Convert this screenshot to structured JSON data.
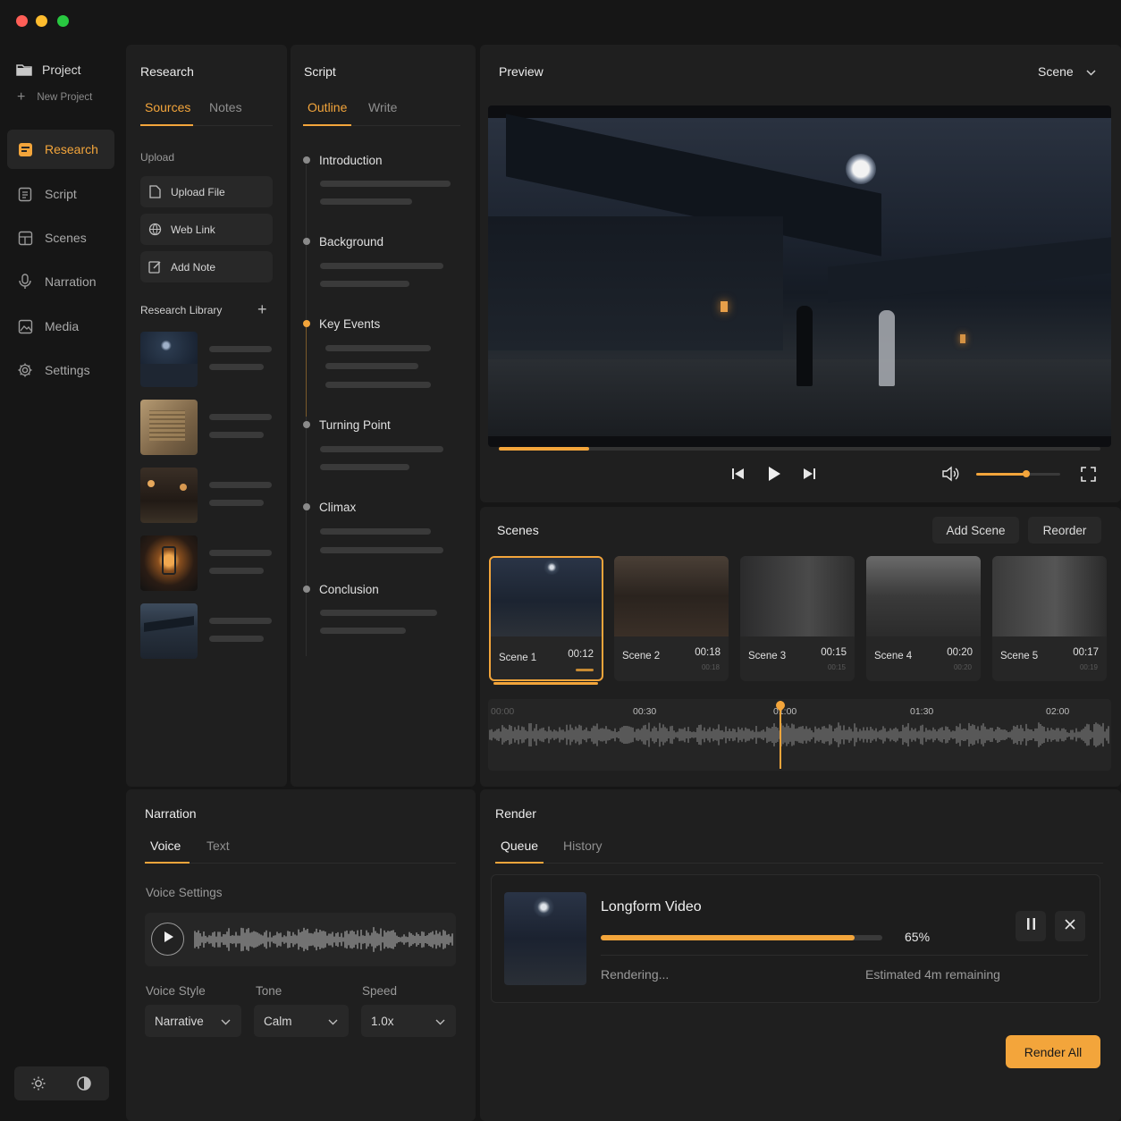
{
  "window": {
    "colors": {
      "close": "#ff5f57",
      "minimize": "#febc2e",
      "maximize": "#28c840",
      "accent": "#f3a53b"
    }
  },
  "sidebar": {
    "project_label": "Project",
    "new_project_label": "New Project",
    "items": [
      {
        "label": "Research",
        "icon": "research-icon",
        "active": true
      },
      {
        "label": "Script",
        "icon": "script-icon"
      },
      {
        "label": "Scenes",
        "icon": "scenes-icon"
      },
      {
        "label": "Narration",
        "icon": "microphone-icon"
      },
      {
        "label": "Media",
        "icon": "media-icon"
      },
      {
        "label": "Settings",
        "icon": "gear-icon"
      }
    ],
    "theme_buttons": [
      "sun-icon",
      "contrast-icon"
    ]
  },
  "research": {
    "title": "Research",
    "tabs": [
      "Sources",
      "Notes"
    ],
    "upload_label": "Upload",
    "buttons": [
      "Upload File",
      "Web Link",
      "Add Note"
    ],
    "library_title": "Research Library"
  },
  "script": {
    "title": "Script",
    "tabs": [
      "Outline",
      "Write"
    ],
    "outline": [
      "Introduction",
      "Background",
      "Key Events",
      "Turning Point",
      "Climax",
      "Conclusion"
    ]
  },
  "preview": {
    "title": "Preview",
    "dropdown": "Scene",
    "progress": 0.15,
    "volume": 0.6
  },
  "scenes": {
    "title": "Scenes",
    "add_label": "Add Scene",
    "reorder_label": "Reorder",
    "items": [
      {
        "label": "Scene 1",
        "duration": "00:12",
        "selected": true
      },
      {
        "label": "Scene 2",
        "duration": "00:18",
        "sub": "00:18"
      },
      {
        "label": "Scene 3",
        "duration": "00:15",
        "sub": "00:15"
      },
      {
        "label": "Scene 4",
        "duration": "00:20",
        "sub": "00:20"
      },
      {
        "label": "Scene 5",
        "duration": "00:17",
        "sub": "00:19"
      }
    ],
    "timeline": {
      "ticks": [
        "00:00",
        "00:30",
        "01:00",
        "01:30",
        "02:00"
      ],
      "playhead": "01:00"
    }
  },
  "narration": {
    "title": "Narration",
    "tabs": [
      "Voice",
      "Text"
    ],
    "voice_settings_label": "Voice Settings",
    "fields": [
      {
        "label": "Voice Style",
        "value": "Narrative"
      },
      {
        "label": "Tone",
        "value": "Calm"
      },
      {
        "label": "Speed",
        "value": "1.0x"
      }
    ]
  },
  "render": {
    "title": "Render",
    "tabs": [
      "Queue",
      "History"
    ],
    "job": {
      "name": "Longform Video",
      "percent_label": "65%",
      "progress": 0.9,
      "status": "Rendering...",
      "eta": "Estimated 4m remaining"
    },
    "render_all_label": "Render All"
  }
}
